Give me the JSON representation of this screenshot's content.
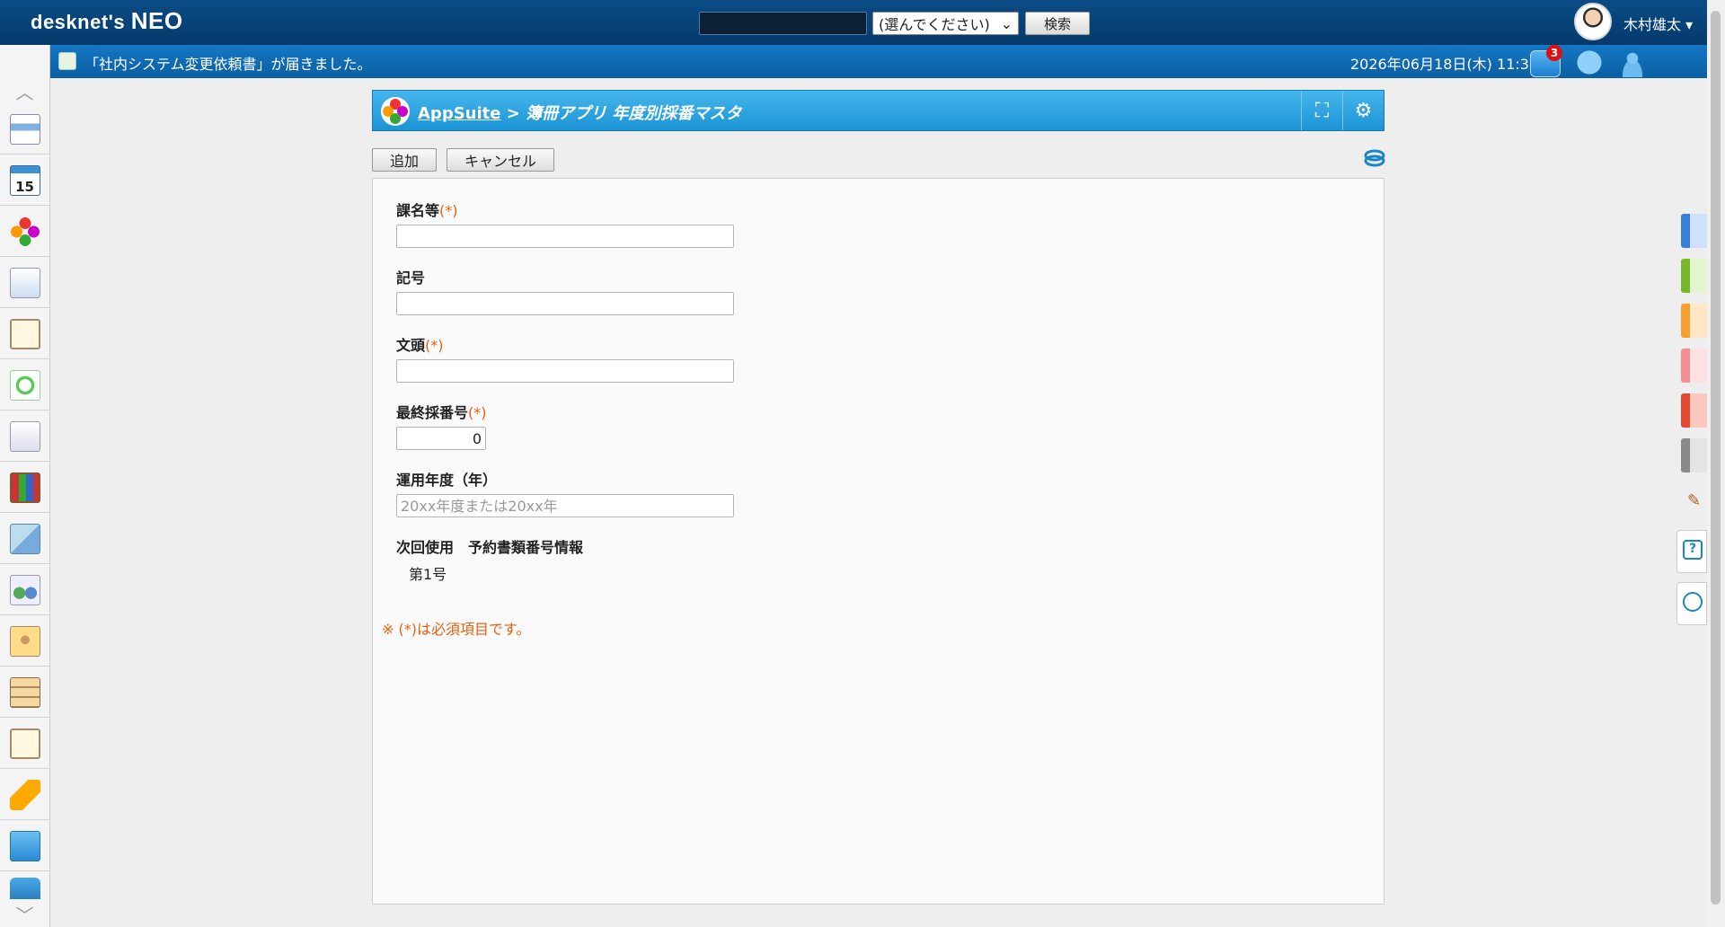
{
  "header": {
    "logo_text": "desknet's",
    "logo_neo": "NEO",
    "search_placeholder": "",
    "search_select": "(選んでください)",
    "search_button": "検索",
    "user_name": "木村雄太"
  },
  "notification": {
    "message": "「社内システム変更依頼書」が届きました。",
    "datetime": "2026年06月18日(木) 11:38",
    "badge_count": "3"
  },
  "sidebar": {
    "icons": [
      "portal-icon",
      "calendar-icon",
      "appsuite-icon",
      "facility-icon",
      "notice-icon",
      "workflow-icon",
      "report-icon",
      "cabinet-icon",
      "webmail-icon",
      "addressbook-icon",
      "user-info-icon",
      "document-icon",
      "todo-icon",
      "safety-icon",
      "neo-app-icon",
      "business-card-icon"
    ],
    "calendar_day": "15"
  },
  "titlebar": {
    "app_link": "AppSuite",
    "separator": ">",
    "path": "簿冊アプリ  年度別採番マスタ"
  },
  "toolbar": {
    "add_label": "追加",
    "cancel_label": "キャンセル"
  },
  "form": {
    "required_mark": "(*)",
    "fields": {
      "section_name": {
        "label": "課名等",
        "value": ""
      },
      "symbol": {
        "label": "記号",
        "value": ""
      },
      "heading": {
        "label": "文頭",
        "value": ""
      },
      "last_number": {
        "label": "最終採番号",
        "value": "0"
      },
      "fiscal_year": {
        "label": "運用年度（年）",
        "value": "",
        "placeholder": "20xx年度または20xx年"
      },
      "next_reserved": {
        "label": "次回使用　予約書類番号情報",
        "value": "第1号"
      }
    },
    "note": "※ (*)は必須項目です。"
  }
}
